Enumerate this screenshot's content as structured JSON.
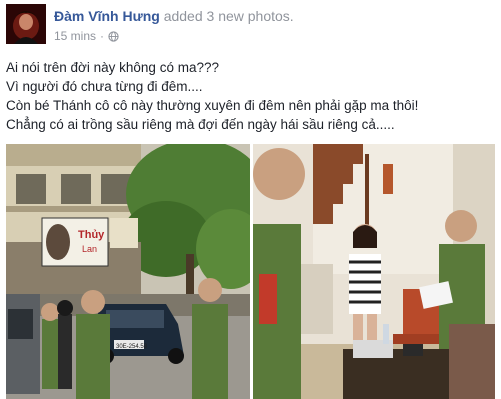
{
  "post": {
    "author_name": "Đàm Vĩnh Hưng",
    "action_text": "added 3 new photos.",
    "timestamp": "15 mins",
    "separator": "·",
    "privacy_icon": "globe-icon",
    "caption_lines": [
      "Ai nói trên đời này không có ma???",
      "Vì người đó chưa từng đi đêm....",
      "Còn bé Thánh cô cô này thường xuyên đi đêm nên phải gặp ma thôi!",
      "Chẳng có ai trồng sầu riêng mà đợi đến ngày hái sầu riêng cả....."
    ],
    "photos": [
      {
        "sign_text_1": "Thủy",
        "sign_text_2": "Lan",
        "plate_text": "30E-254.58"
      },
      {}
    ]
  },
  "colors": {
    "link": "#365899",
    "meta": "#90949c",
    "text": "#1d2129",
    "uniform": "#5a7a3a"
  }
}
